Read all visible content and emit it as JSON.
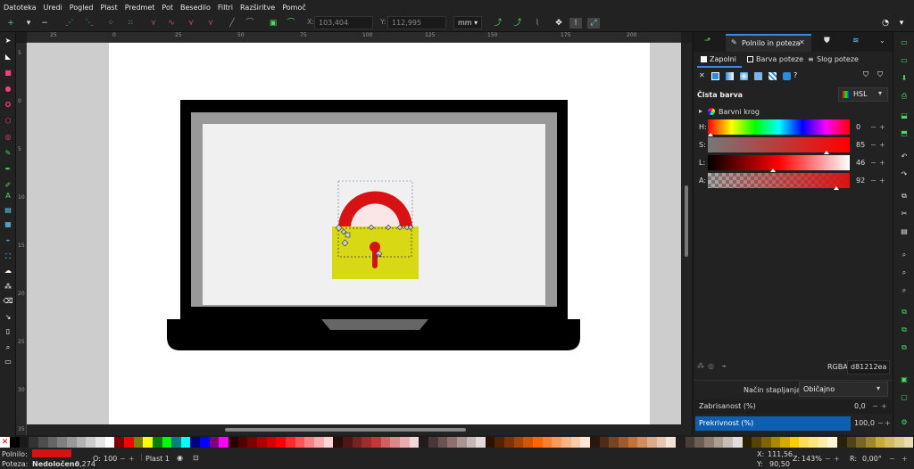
{
  "menu": [
    "Datoteka",
    "Uredi",
    "Pogled",
    "Plast",
    "Predmet",
    "Pot",
    "Besedilo",
    "Filtri",
    "Razširitve",
    "Pomoč"
  ],
  "toolctrl": {
    "x_label": "X:",
    "x_value": "103,404",
    "y_label": "Y:",
    "y_value": "112,995",
    "unit": "mm"
  },
  "ruler": {
    "h": [
      "25",
      "0",
      "25",
      "50",
      "75",
      "100",
      "125",
      "150",
      "175",
      "200"
    ],
    "v": [
      "5",
      "0",
      "5",
      "10",
      "15",
      "20",
      "25",
      "30",
      "35"
    ]
  },
  "panel": {
    "tabs": [
      {
        "label": "Polnilo in poteza"
      }
    ],
    "subtabs": [
      {
        "label": "Zapolni"
      },
      {
        "label": "Barva poteze"
      },
      {
        "label": "Slog poteze"
      }
    ],
    "fill_type_title": "Čista barva",
    "mode": "HSL",
    "wheel_label": "Barvni krog",
    "channels": [
      {
        "label": "H:",
        "value": "0",
        "frac": 0.0
      },
      {
        "label": "S:",
        "value": "85",
        "frac": 0.85
      },
      {
        "label": "L:",
        "value": "46",
        "frac": 0.46
      },
      {
        "label": "A:",
        "value": "92",
        "frac": 0.92
      }
    ],
    "rgba_label": "RGBA:",
    "rgba_value": "d81212ea",
    "blend_label": "Način stapljanja:",
    "blend_value": "Običajno",
    "blur_label": "Zabrisanost (%)",
    "blur_value": "0,0",
    "opacity_label": "Prekrivnost (%)",
    "opacity_value": "100,0"
  },
  "status": {
    "fill_label": "Polnilo:",
    "stroke_label": "Poteza:",
    "stroke_value": "Nedoločeno",
    "stroke_width": "0,274",
    "o_label": "O:",
    "o_value": "100",
    "layer": "Plast 1",
    "x_label": "X:",
    "x": "111,56",
    "y_label": "Y:",
    "y": "90,50",
    "z_label": "Z:",
    "zoom": "143%",
    "r_label": "R:",
    "rotation": "0,00°"
  },
  "colors": {
    "accent": "#0f5fb0",
    "fill": "#d81212",
    "lock_body": "#d9d814",
    "laptop_frame": "#000000",
    "screen_bezel": "#999999",
    "screen": "#f0f0f1",
    "page": "#ffffff",
    "canvas_bg": "#cdcdcd"
  },
  "palette": [
    "#000000",
    "#1a1a1a",
    "#333333",
    "#4d4d4d",
    "#666666",
    "#808080",
    "#999999",
    "#b3b3b3",
    "#cccccc",
    "#e6e6e6",
    "#ffffff",
    "#800000",
    "#ff0000",
    "#808000",
    "#ffff00",
    "#008000",
    "#00ff00",
    "#008080",
    "#00ffff",
    "#000080",
    "#0000ff",
    "#800080",
    "#ff00ff",
    "#2b0000",
    "#550000",
    "#800000",
    "#aa0000",
    "#d40000",
    "#ff0000",
    "#ff2a2a",
    "#ff5555",
    "#ff8080",
    "#ffaaaa",
    "#ffd5d5",
    "#280b0b",
    "#501616",
    "#782121",
    "#a02c2c",
    "#c83737",
    "#d35f5f",
    "#de8787",
    "#e9afaf",
    "#f4d7d7",
    "#241c1c",
    "#483737",
    "#6c5353",
    "#916f6f",
    "#ac9393",
    "#c8b7b7",
    "#e3dbdb",
    "#2b1100",
    "#552200",
    "#803300",
    "#aa4400",
    "#d45500",
    "#ff6600",
    "#ff7f2a",
    "#ff9955",
    "#ffb380",
    "#ffccaa",
    "#ffe6d5",
    "#28170b",
    "#502d16",
    "#784421",
    "#a05a2c",
    "#c87137",
    "#d38d5f",
    "#deaa87",
    "#e9c6af",
    "#f4e3d7",
    "#241f1c",
    "#483e37",
    "#6c5d53",
    "#917c6f",
    "#ac9d93",
    "#c8beb7",
    "#e3dedb",
    "#2b2200",
    "#554400",
    "#806600",
    "#aa8800",
    "#d4aa00",
    "#ffcc00",
    "#ffdd55",
    "#ffe680",
    "#ffeeaa",
    "#fff6d5",
    "#28220b",
    "#504416",
    "#786721",
    "#a0892c",
    "#c8ab37",
    "#d3bc5f",
    "#decd87",
    "#e9ddaf"
  ],
  "icons": {
    "menu": "hamburger-icon",
    "close": "close-icon",
    "chevron": "chevron-down-icon"
  }
}
